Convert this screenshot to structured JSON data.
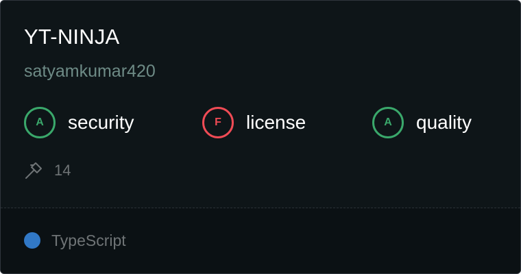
{
  "repo": {
    "name": "YT-NINJA",
    "owner": "satyamkumar420"
  },
  "grades": [
    {
      "letter": "A",
      "label": "security",
      "status": "good",
      "color": "#3aa86b"
    },
    {
      "letter": "F",
      "label": "license",
      "status": "bad",
      "color": "#f04b55"
    },
    {
      "letter": "A",
      "label": "quality",
      "status": "good",
      "color": "#3aa86b"
    }
  ],
  "builds": {
    "icon": "hammer-icon",
    "count": "14"
  },
  "language": {
    "name": "TypeScript",
    "color": "#3178c6"
  },
  "colors": {
    "background": "#0e1518",
    "footer_background": "#0b1114"
  }
}
